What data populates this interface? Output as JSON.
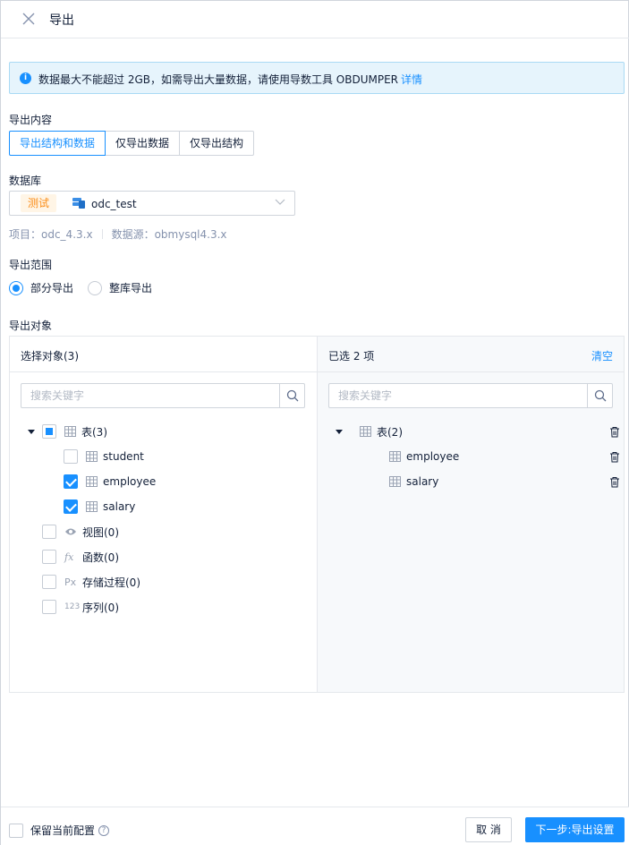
{
  "header": {
    "title": "导出"
  },
  "alert": {
    "message": "数据最大不能超过 2GB，如需导出大量数据，请使用导数工具 OBDUMPER",
    "link": "详情"
  },
  "export_content": {
    "label": "导出内容",
    "options": [
      "导出结构和数据",
      "仅导出数据",
      "仅导出结构"
    ],
    "selected": "导出结构和数据"
  },
  "database": {
    "label": "数据库",
    "env_tag": "测试",
    "name": "odc_test",
    "project": "项目：odc_4.3.x",
    "datasource": "数据源：obmysql4.3.x"
  },
  "scope": {
    "label": "导出范围",
    "options": [
      "部分导出",
      "整库导出"
    ],
    "selected": "部分导出"
  },
  "objects": {
    "label": "导出对象",
    "left": {
      "title": "选择对象(3)",
      "search_placeholder": "搜索关键字",
      "tree": {
        "tables_label": "表(3)",
        "tables": [
          {
            "name": "student",
            "checked": false
          },
          {
            "name": "employee",
            "checked": true
          },
          {
            "name": "salary",
            "checked": true
          }
        ],
        "others": [
          {
            "label": "视图(0)",
            "icon": "eye-icon"
          },
          {
            "label": "函数(0)",
            "icon": "function-icon"
          },
          {
            "label": "存储过程(0)",
            "icon": "procedure-icon"
          },
          {
            "label": "序列(0)",
            "icon": "sequence-icon"
          }
        ]
      }
    },
    "right": {
      "title": "已选 2 项",
      "clear": "清空",
      "search_placeholder": "搜索关键字",
      "tables_label": "表(2)",
      "selected": [
        "employee",
        "salary"
      ]
    }
  },
  "glyphs": {
    "function": "fx",
    "procedure": "Px",
    "sequence": "123"
  },
  "footer": {
    "keep_config": "保留当前配置",
    "help": "?",
    "cancel": "取 消",
    "next": "下一步:导出设置"
  },
  "colors": {
    "primary": "#1890ff",
    "warning_tag": "#fa8c16"
  }
}
